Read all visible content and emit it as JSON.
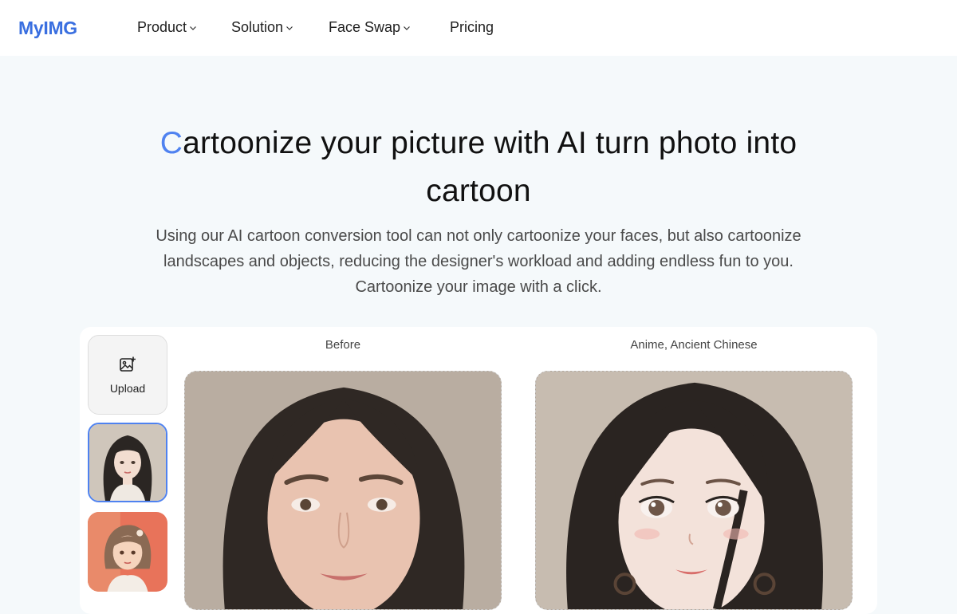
{
  "header": {
    "logo": "MyIMG",
    "nav": [
      {
        "label": "Product",
        "has_dropdown": true
      },
      {
        "label": "Solution",
        "has_dropdown": true
      },
      {
        "label": "Face Swap",
        "has_dropdown": true
      },
      {
        "label": "Pricing",
        "has_dropdown": false
      }
    ]
  },
  "hero": {
    "title_first_letter": "C",
    "title_rest_line1": "artoonize your picture with AI turn photo into",
    "title_line2": "cartoon",
    "subtitle": "Using our AI cartoon conversion tool can not only cartoonize your faces, but also cartoonize landscapes and objects, reducing the designer's workload and adding endless fun to you. Cartoonize your image with a click."
  },
  "tool": {
    "upload_label": "Upload",
    "thumbnails": [
      {
        "style": "anime-ancient-chinese",
        "selected": true
      },
      {
        "style": "cartoon-pastel",
        "selected": false
      }
    ],
    "before_label": "Before",
    "after_label": "Anime, Ancient Chinese"
  },
  "colors": {
    "accent": "#4f82f0",
    "logo": "#3a6fe0",
    "page_bg": "#f5f9fb"
  }
}
